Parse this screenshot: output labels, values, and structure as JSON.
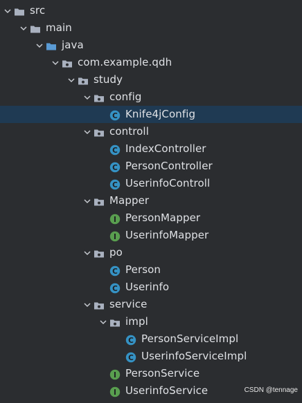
{
  "tree": [
    {
      "label": "src",
      "icon": "folder-icon",
      "expanded": true,
      "depth": 0
    },
    {
      "label": "main",
      "icon": "folder-icon",
      "expanded": true,
      "depth": 1
    },
    {
      "label": "java",
      "icon": "source-folder-icon",
      "expanded": true,
      "depth": 2
    },
    {
      "label": "com.example.qdh",
      "icon": "package-icon",
      "expanded": true,
      "depth": 3
    },
    {
      "label": "study",
      "icon": "package-icon",
      "expanded": true,
      "depth": 4
    },
    {
      "label": "config",
      "icon": "package-icon",
      "expanded": true,
      "depth": 5
    },
    {
      "label": "Knife4jConfig",
      "icon": "class-icon",
      "depth": 6,
      "selected": true
    },
    {
      "label": "controll",
      "icon": "package-icon",
      "expanded": true,
      "depth": 5
    },
    {
      "label": "IndexController",
      "icon": "class-icon",
      "depth": 6
    },
    {
      "label": "PersonController",
      "icon": "class-icon",
      "depth": 6
    },
    {
      "label": "UserinfoControll",
      "icon": "class-icon",
      "depth": 6
    },
    {
      "label": "Mapper",
      "icon": "package-icon",
      "expanded": true,
      "depth": 5
    },
    {
      "label": "PersonMapper",
      "icon": "interface-icon",
      "depth": 6
    },
    {
      "label": "UserinfoMapper",
      "icon": "interface-icon",
      "depth": 6
    },
    {
      "label": "po",
      "icon": "package-icon",
      "expanded": true,
      "depth": 5
    },
    {
      "label": "Person",
      "icon": "class-icon",
      "depth": 6
    },
    {
      "label": "Userinfo",
      "icon": "class-icon",
      "depth": 6
    },
    {
      "label": "service",
      "icon": "package-icon",
      "expanded": true,
      "depth": 5
    },
    {
      "label": "impl",
      "icon": "package-icon",
      "expanded": true,
      "depth": 6
    },
    {
      "label": "PersonServiceImpl",
      "icon": "class-icon",
      "depth": 7
    },
    {
      "label": "UserinfoServiceImpl",
      "icon": "class-icon",
      "depth": 7
    },
    {
      "label": "PersonService",
      "icon": "interface-icon",
      "depth": 6
    },
    {
      "label": "UserinfoService",
      "icon": "interface-icon",
      "depth": 6
    }
  ],
  "icon_letters": {
    "class-icon": "C",
    "interface-icon": "I"
  },
  "colors": {
    "background": "#2b2d30",
    "selection": "#1f3a53",
    "text": "#dfe1e5",
    "folder": "#a9b1bf",
    "source_folder": "#5a9bd5",
    "class_icon": "#3592c4",
    "interface_icon": "#599e4f",
    "chevron": "#c9ccd2"
  },
  "watermark": "CSDN @tennage"
}
